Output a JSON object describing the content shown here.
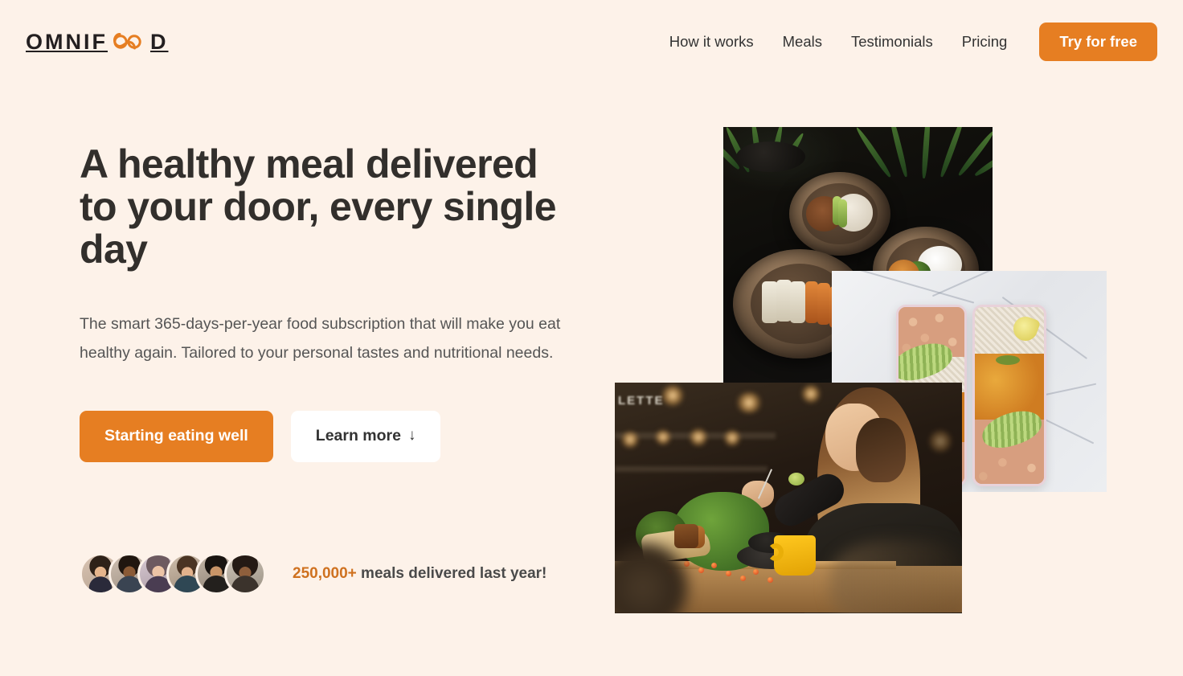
{
  "brand": {
    "name_part1": "OMNIF",
    "logo_icon": "infinity-icon",
    "name_part2": "D",
    "accent_color": "#e67e22",
    "text_color": "#231f20"
  },
  "header": {
    "background": "#fdf2e9",
    "nav": [
      {
        "label": "How it works"
      },
      {
        "label": "Meals"
      },
      {
        "label": "Testimonials"
      },
      {
        "label": "Pricing"
      }
    ],
    "cta": {
      "label": "Try for free",
      "background": "#e67e22",
      "color": "#ffffff"
    }
  },
  "hero": {
    "title": "A healthy meal delivered to your door, every single day",
    "description": "The smart 365-days-per-year food subscription that will make you eat healthy again. Tailored to your personal tastes and nutritional needs.",
    "primary_button": {
      "label": "Starting eating well",
      "background": "#e67e22",
      "color": "#ffffff"
    },
    "secondary_button": {
      "label": "Learn more",
      "arrow": "↓",
      "background": "#ffffff",
      "color": "#333333"
    },
    "social_proof": {
      "avatar_count": 6,
      "avatars": [
        {
          "alt": "customer-1"
        },
        {
          "alt": "customer-2"
        },
        {
          "alt": "customer-3"
        },
        {
          "alt": "customer-4"
        },
        {
          "alt": "customer-5"
        },
        {
          "alt": "customer-6"
        }
      ],
      "count": "250,000+",
      "count_color": "#cf711f",
      "text": " meals delivered last year!"
    },
    "images": [
      {
        "name": "meal-bowls-photo",
        "alt": "Bowls of healthy food on a dark table with plants"
      },
      {
        "name": "meal-prep-boxes-photo",
        "alt": "Meal prep containers with chickpeas, avocado, rice and curry on marble"
      },
      {
        "name": "woman-eating-photo",
        "alt": "Woman enjoying a healthy meal in a restaurant"
      }
    ]
  }
}
